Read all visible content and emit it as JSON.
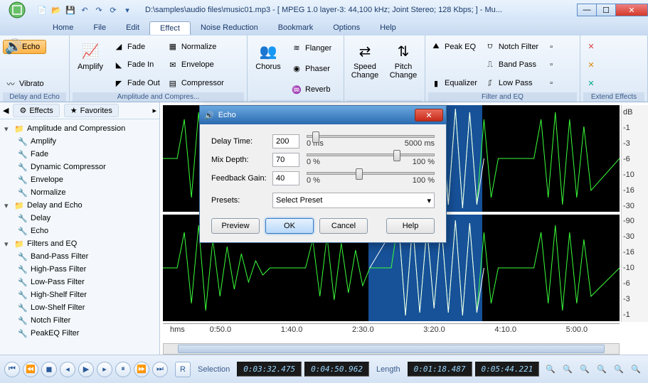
{
  "title": "D:\\samples\\audio files\\music01.mp3 - [ MPEG 1.0 layer-3: 44,100 kHz; Joint Stereo; 128 Kbps;  ] - Mu...",
  "menu": {
    "items": [
      "Home",
      "File",
      "Edit",
      "Effect",
      "Noise Reduction",
      "Bookmark",
      "Options",
      "Help"
    ],
    "active": "Effect"
  },
  "ribbon": {
    "g1": {
      "label": "Delay and Echo",
      "echo": "Echo",
      "vibrato": "Vibrato"
    },
    "g2": {
      "label": "Amplitude and Compres...",
      "amplify": "Amplify",
      "fade": "Fade",
      "fadein": "Fade In",
      "fadeout": "Fade Out",
      "normalize": "Normalize",
      "envelope": "Envelope",
      "compressor": "Compressor"
    },
    "g3": {
      "label": "",
      "chorus": "Chorus",
      "flanger": "Flanger",
      "phaser": "Phaser",
      "reverb": "Reverb"
    },
    "g4": {
      "label": "",
      "speed": "Speed Change",
      "pitch": "Pitch Change"
    },
    "g5": {
      "label": "Filter and EQ",
      "peakeq": "Peak EQ",
      "equalizer": "Equalizer",
      "notch": "Notch Filter",
      "bandpass": "Band Pass",
      "lowpass": "Low Pass"
    },
    "g6": {
      "label": "Extend Effects"
    }
  },
  "side": {
    "tab_effects": "Effects",
    "tab_fav": "Favorites",
    "groups": [
      {
        "name": "Amplitude and Compression",
        "items": [
          "Amplify",
          "Fade",
          "Dynamic Compressor",
          "Envelope",
          "Normalize"
        ]
      },
      {
        "name": "Delay and Echo",
        "items": [
          "Delay",
          "Echo"
        ]
      },
      {
        "name": "Filters and EQ",
        "items": [
          "Band-Pass Filter",
          "High-Pass Filter",
          "Low-Pass Filter",
          "High-Shelf Filter",
          "Low-Shelf Filter",
          "Notch Filter",
          "PeakEQ Filter"
        ]
      }
    ]
  },
  "timeline": {
    "unit": "hms",
    "ticks": [
      "0:50.0",
      "1:40.0",
      "2:30.0",
      "3:20.0",
      "4:10.0",
      "5:00.0"
    ]
  },
  "db_labels": [
    "dB",
    "-1",
    "-3",
    "-6",
    "-10",
    "-16",
    "-30",
    "-90",
    "-30",
    "-16",
    "-10",
    "-6",
    "-3",
    "-1"
  ],
  "bottom": {
    "selection_label": "Selection",
    "sel_start": "0:03:32.475",
    "sel_end": "0:04:50.962",
    "length_label": "Length",
    "len1": "0:01:18.487",
    "len2": "0:05:44.221"
  },
  "dialog": {
    "title": "Echo",
    "delay_label": "Delay Time:",
    "delay_val": "200",
    "delay_min": "0 ms",
    "delay_max": "5000 ms",
    "mix_label": "Mix Depth:",
    "mix_val": "70",
    "mix_min": "0 %",
    "mix_max": "100 %",
    "fb_label": "Feedback Gain:",
    "fb_val": "40",
    "fb_min": "0 %",
    "fb_max": "100 %",
    "presets_label": "Presets:",
    "presets_sel": "Select Preset",
    "btn_preview": "Preview",
    "btn_ok": "OK",
    "btn_cancel": "Cancel",
    "btn_help": "Help"
  }
}
